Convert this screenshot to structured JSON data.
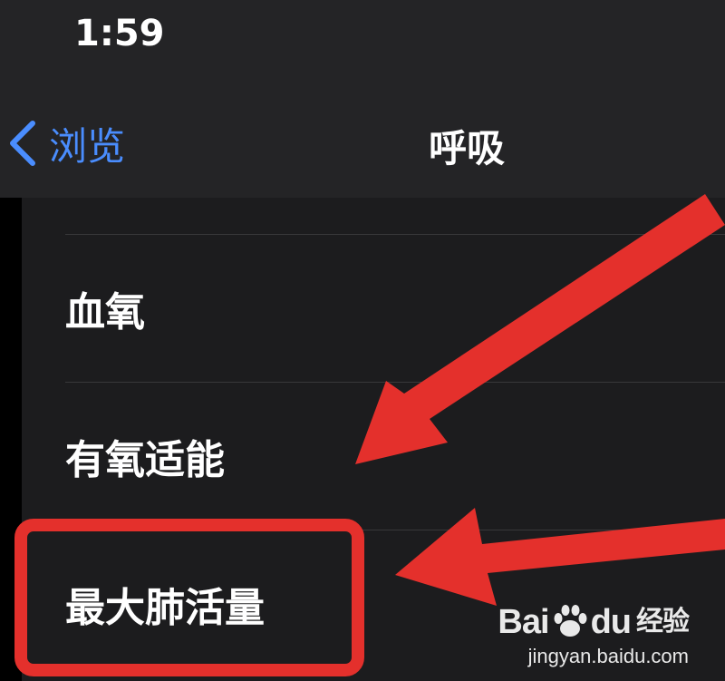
{
  "status_bar": {
    "time": "1:59"
  },
  "nav": {
    "back_label": "浏览",
    "title": "呼吸"
  },
  "list": {
    "items": [
      {
        "label": "血氧"
      },
      {
        "label": "有氧适能"
      },
      {
        "label": "最大肺活量"
      }
    ]
  },
  "watermark": {
    "brand_prefix": "Bai",
    "brand_suffix": "du",
    "brand_cn": "经验",
    "url": "jingyan.baidu.com"
  },
  "colors": {
    "accent": "#4a8dfe",
    "annotation_red": "#e4302c",
    "background": "#1c1c1e",
    "nav_background": "#242426"
  }
}
